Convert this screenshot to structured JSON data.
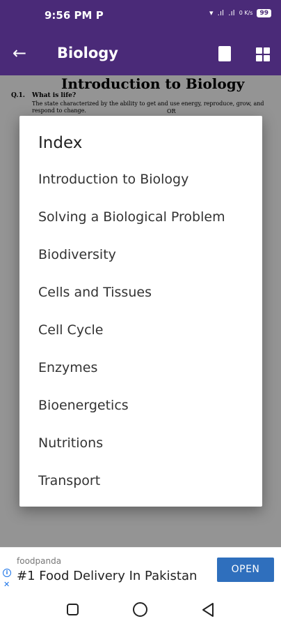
{
  "statusbar": {
    "time": "9:56 PM",
    "carrier_icon": "P",
    "network_rate": "0 K/s",
    "battery": "99"
  },
  "appbar": {
    "title": "Biology",
    "back_icon": "arrow-left-icon",
    "bookmark_icon": "book-icon",
    "grid_icon": "grid-icon"
  },
  "document": {
    "title": "Introduction to Biology",
    "q1_number": "Q.1.",
    "q1_heading": "What is life?",
    "q1_body": "The state characterized by the ability to get and use energy, reproduce, grow, and respond to change.",
    "q1_or": "OR"
  },
  "dialog": {
    "title": "Index",
    "items": [
      "Introduction to Biology",
      "Solving a Biological Problem",
      "Biodiversity",
      "Cells and Tissues",
      "Cell Cycle",
      "Enzymes",
      "Bioenergetics",
      "Nutritions",
      "Transport"
    ]
  },
  "ad": {
    "brand": "foodpanda",
    "headline": "#1 Food Delivery In Pakistan",
    "cta": "OPEN"
  },
  "colors": {
    "primary": "#4a2a78",
    "ad_button": "#2f6fbd"
  }
}
